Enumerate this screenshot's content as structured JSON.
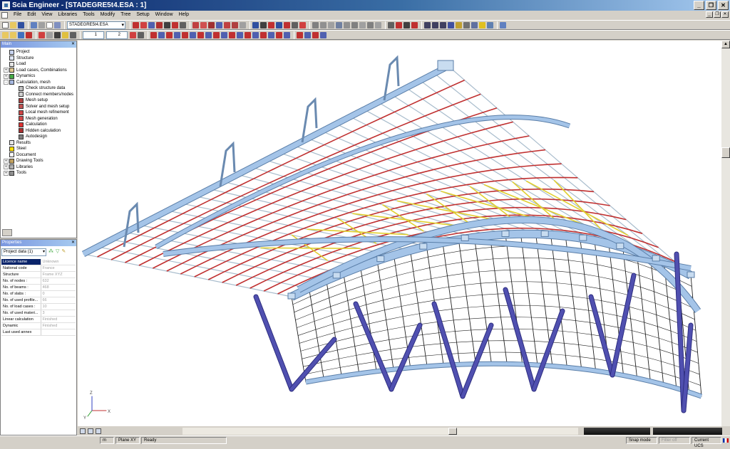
{
  "window": {
    "title": "Scia Engineer - [STADEGRE5t4.ESA : 1]",
    "controls": [
      "_",
      "❐",
      "✕"
    ]
  },
  "menu": {
    "items": [
      "File",
      "Edit",
      "View",
      "Libraries",
      "Tools",
      "Modify",
      "Tree",
      "Setup",
      "Window",
      "Help"
    ]
  },
  "toolbar": {
    "file_combo": "STADEGRE5t4.ESA",
    "spin1": "1",
    "spin2": "2"
  },
  "main_panel": {
    "title": "Main",
    "tree": [
      {
        "label": "Project",
        "level": 1,
        "exp": "",
        "icon": "project-icon",
        "color": "#c8d4f0"
      },
      {
        "label": "Structure",
        "level": 1,
        "exp": "",
        "icon": "structure-icon",
        "color": "#dfe6f5"
      },
      {
        "label": "Load",
        "level": 1,
        "exp": "",
        "icon": "load-icon",
        "color": "#e6e6e6"
      },
      {
        "label": "Load cases, Combinations",
        "level": 1,
        "exp": "+",
        "icon": "load-cases-icon",
        "color": "#e0c890"
      },
      {
        "label": "Dynamics",
        "level": 1,
        "exp": "+",
        "icon": "dynamics-icon",
        "color": "#44aa44"
      },
      {
        "label": "Calculation, mesh",
        "level": 1,
        "exp": "-",
        "icon": "calculation-icon",
        "color": "#a6b8e0"
      },
      {
        "label": "Check structure data",
        "level": 2,
        "exp": "",
        "icon": "check-data-icon",
        "color": "#c0c0c0"
      },
      {
        "label": "Connect members/nodes",
        "level": 2,
        "exp": "",
        "icon": "connect-icon",
        "color": "#d0d0d0"
      },
      {
        "label": "Mesh setup",
        "level": 2,
        "exp": "",
        "icon": "mesh-setup-icon",
        "color": "#b04040"
      },
      {
        "label": "Solver and mesh setup",
        "level": 2,
        "exp": "",
        "icon": "solver-icon",
        "color": "#c05050"
      },
      {
        "label": "Local mesh refinement",
        "level": 2,
        "exp": "",
        "icon": "mesh-refine-icon",
        "color": "#cc4444"
      },
      {
        "label": "Mesh generation",
        "level": 2,
        "exp": "",
        "icon": "mesh-gen-icon",
        "color": "#d04848"
      },
      {
        "label": "Calculation",
        "level": 2,
        "exp": "",
        "icon": "calc-icon",
        "color": "#dd3333"
      },
      {
        "label": "Hidden calculation",
        "level": 2,
        "exp": "",
        "icon": "hidden-calc-icon",
        "color": "#aa3030"
      },
      {
        "label": "Autodesign",
        "level": 2,
        "exp": "",
        "icon": "autodesign-icon",
        "color": "#808080"
      },
      {
        "label": "Results",
        "level": 1,
        "exp": "",
        "icon": "results-icon",
        "color": "#e6e6e6"
      },
      {
        "label": "Steel",
        "level": 1,
        "exp": "",
        "icon": "steel-icon",
        "color": "#ffdd00"
      },
      {
        "label": "Document",
        "level": 1,
        "exp": "",
        "icon": "document-icon",
        "color": "#ffffff"
      },
      {
        "label": "Drawing Tools",
        "level": 1,
        "exp": "+",
        "icon": "drawing-tools-icon",
        "color": "#c0a060"
      },
      {
        "label": "Libraries",
        "level": 1,
        "exp": "+",
        "icon": "libraries-icon",
        "color": "#b0b0b0"
      },
      {
        "label": "Tools",
        "level": 1,
        "exp": "+",
        "icon": "tools-icon",
        "color": "#909090"
      }
    ]
  },
  "properties_panel": {
    "title": "Properties",
    "selector": "Project data (1)",
    "rows": [
      {
        "key": "Licence name",
        "value": "Unknown"
      },
      {
        "key": "National code",
        "value": "France"
      },
      {
        "key": "Structure",
        "value": "Frame XYZ"
      },
      {
        "key": "No. of nodes :",
        "value": "632"
      },
      {
        "key": "No. of beams :",
        "value": "468"
      },
      {
        "key": "No. of slabs :",
        "value": "0"
      },
      {
        "key": "No. of used profile...",
        "value": "66"
      },
      {
        "key": "No. of load cases :",
        "value": "10"
      },
      {
        "key": "No. of used materi...",
        "value": "3"
      },
      {
        "key": "Linear calculation",
        "value": "Finished"
      },
      {
        "key": "Dynamic",
        "value": "Finished"
      },
      {
        "key": "Last used annex",
        "value": ""
      }
    ]
  },
  "viewport": {
    "axes": {
      "x": "X",
      "y": "Y",
      "z": "Z"
    },
    "colors": {
      "beam": "#a4c4e8",
      "column": "#5050b0",
      "purlin": "#c03030",
      "bracing": "#e0d030",
      "rib": "#222222"
    }
  },
  "statusbar": {
    "unit": "m",
    "plane": "Plane XY",
    "status": "Ready",
    "snap": "Snap mode",
    "filter": "Filter off",
    "ucs": "Current UCS"
  }
}
